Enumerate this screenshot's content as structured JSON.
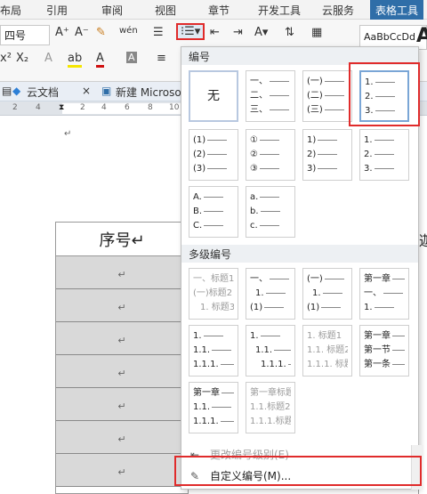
{
  "ribbon_tabs": [
    "布局",
    "引用",
    "审阅",
    "视图",
    "章节",
    "开发工具",
    "云服务",
    "表格工具"
  ],
  "ribbon": {
    "font_size": "四号",
    "grow_font": "A⁺",
    "shrink_font": "A⁻",
    "clear_format": "✎",
    "phonetic": "wén",
    "superscript": "x²",
    "subscript": "X₂",
    "text_effect": "A",
    "highlight": "ab",
    "font_color": "A",
    "char_border": "A",
    "style_preview": "AaBbCcDd",
    "big_a": "A"
  },
  "doc_tabs": [
    {
      "label": "云文档"
    },
    {
      "label": "×"
    },
    {
      "label": "新建 Microso"
    }
  ],
  "ruler_numbers": [
    "2",
    "4",
    "2",
    "4",
    "6",
    "8",
    "10",
    "12"
  ],
  "document": {
    "para_mark": "↵",
    "table_header": "序号↵",
    "row_mark": "↵",
    "row_count": 7,
    "edge_text": "迦"
  },
  "panel": {
    "section_numbering": "编号",
    "section_multilevel": "多级编号",
    "none_label": "无",
    "numbering_options": [
      [
        "一、",
        "二、",
        "三、"
      ],
      [
        "(一)",
        "(二)",
        "(三)"
      ],
      [
        "1.",
        "2.",
        "3."
      ],
      [
        "(1)",
        "(2)",
        "(3)"
      ],
      [
        "①",
        "②",
        "③"
      ],
      [
        "1)",
        "2)",
        "3)"
      ],
      [
        "1.",
        "2.",
        "3."
      ],
      [
        "A.",
        "B.",
        "C."
      ],
      [
        "a.",
        "b.",
        "c."
      ]
    ],
    "multilevel_options": [
      [
        "一、标题1",
        "(一)标题2",
        "1. 标题3"
      ],
      [
        "一、",
        "1.",
        "(1)"
      ],
      [
        "(一)",
        "1.",
        "(1)"
      ],
      [
        "第一章",
        "一、",
        "1."
      ],
      [
        "1.",
        "1.1.",
        "1.1.1."
      ],
      [
        "1.",
        "1.1.",
        "1.1.1."
      ],
      [
        "1. 标题1",
        "1.1. 标题2",
        "1.1.1. 标题3"
      ],
      [
        "第一章",
        "第一节",
        "第一条"
      ],
      [
        "第一章",
        "1.1.",
        "1.1.1."
      ],
      [
        "第一章标题1",
        "1.1.标题2",
        "1.1.1.标题3"
      ]
    ],
    "change_level_label": "更改编号级别(E)",
    "custom_label": "自定义编号(M)...",
    "change_level_icon": "indent-icon",
    "custom_icon": "pencil-icon"
  },
  "accent_color": "#e02b2b"
}
